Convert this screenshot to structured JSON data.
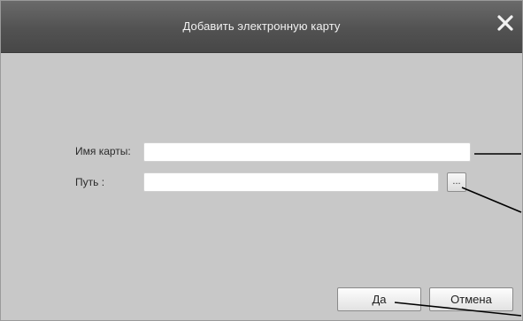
{
  "window": {
    "title": "Добавить электронную карту",
    "close_icon": "close-icon"
  },
  "form": {
    "map_name_label": "Имя карты:",
    "map_name_value": "",
    "path_label": "Путь :",
    "path_value": "",
    "browse_label": "..."
  },
  "buttons": {
    "ok_label": "Да",
    "cancel_label": "Отмена"
  },
  "colors": {
    "titlebar": "#525252",
    "body": "#c8c8c8"
  }
}
